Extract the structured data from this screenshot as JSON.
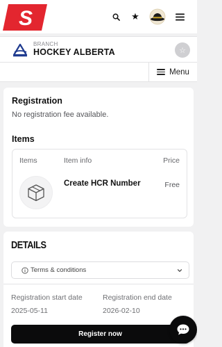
{
  "header": {
    "logo_icon": "spordle-s-logo",
    "icons": [
      "search-icon",
      "star-icon",
      "avatar-hat-icon",
      "hamburger-icon"
    ]
  },
  "org": {
    "type_label": "BRANCH",
    "name": "HOCKEY ALBERTA",
    "logo_icon": "hockey-alberta-logo",
    "favorite_icon": "star-icon"
  },
  "menu": {
    "label": "Menu"
  },
  "registration": {
    "title": "Registration",
    "fee_text": "No registration fee available."
  },
  "items": {
    "title": "Items",
    "columns": [
      "Items",
      "Item info",
      "Price"
    ],
    "rows": [
      {
        "icon": "package-icon",
        "name": "Create HCR Number",
        "price": "Free"
      }
    ]
  },
  "details": {
    "title": "DETAILS",
    "terms_label": "Terms & conditions",
    "start_label": "Registration start date",
    "start_value": "2025-05-11",
    "end_label": "Registration end date",
    "end_value": "2026-02-10",
    "register_label": "Register now"
  },
  "colors": {
    "brand_red": "#e3262f",
    "primary_button": "#0b0b0c",
    "page_bg": "#f1f1f2"
  }
}
